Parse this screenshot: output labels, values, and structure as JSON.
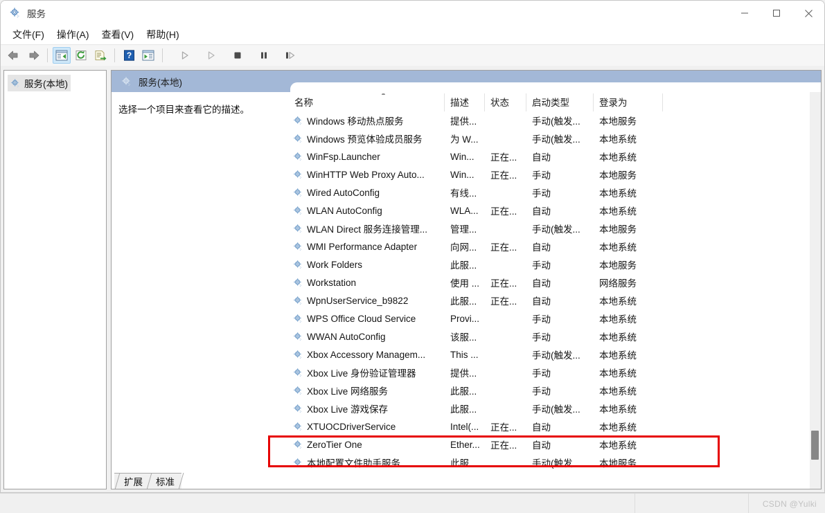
{
  "window": {
    "title": "服务",
    "icon": "services-gear-icon",
    "controls": {
      "minimize": "minimize-icon",
      "maximize": "maximize-icon",
      "close": "close-icon"
    }
  },
  "menubar": {
    "items": [
      {
        "label": "文件(F)",
        "name": "menu-file"
      },
      {
        "label": "操作(A)",
        "name": "menu-action"
      },
      {
        "label": "查看(V)",
        "name": "menu-view"
      },
      {
        "label": "帮助(H)",
        "name": "menu-help"
      }
    ]
  },
  "toolbar": {
    "buttons": [
      {
        "name": "back-button",
        "icon": "arrow-left-icon",
        "enabled": true
      },
      {
        "name": "forward-button",
        "icon": "arrow-right-icon",
        "enabled": true
      },
      {
        "name": "show-hide-console-tree-button",
        "icon": "console-tree-icon",
        "active": true
      },
      {
        "name": "refresh-button",
        "icon": "refresh-icon",
        "enabled": true
      },
      {
        "name": "export-list-button",
        "icon": "export-list-icon",
        "enabled": true
      },
      {
        "name": "help-button",
        "icon": "question-mark-icon",
        "enabled": true
      },
      {
        "name": "show-action-pane-button",
        "icon": "action-pane-icon",
        "enabled": true
      },
      {
        "name": "start-service-button",
        "icon": "play-icon",
        "enabled": false
      },
      {
        "name": "resume-service-button",
        "icon": "play-outline-icon",
        "enabled": false
      },
      {
        "name": "stop-service-button",
        "icon": "stop-icon",
        "enabled": true
      },
      {
        "name": "pause-service-button",
        "icon": "pause-icon",
        "enabled": true
      },
      {
        "name": "restart-service-button",
        "icon": "restart-icon",
        "enabled": true
      }
    ]
  },
  "sidebar": {
    "root": {
      "label": "服务(本地)",
      "icon": "services-gear-icon",
      "selected": true
    }
  },
  "banner": {
    "title": "服务(本地)",
    "icon": "services-gear-icon",
    "color": "#a3b8d7"
  },
  "description_pane": {
    "text": "选择一个项目来查看它的描述。"
  },
  "list": {
    "columns": [
      {
        "key": "name",
        "label": "名称",
        "sorted": "asc"
      },
      {
        "key": "desc",
        "label": "描述"
      },
      {
        "key": "state",
        "label": "状态"
      },
      {
        "key": "start",
        "label": "启动类型"
      },
      {
        "key": "logon",
        "label": "登录为"
      }
    ],
    "rows": [
      {
        "name": "Windows 移动热点服务",
        "desc": "提供...",
        "state": "",
        "start": "手动(触发...",
        "logon": "本地服务"
      },
      {
        "name": "Windows 预览体验成员服务",
        "desc": "为 W...",
        "state": "",
        "start": "手动(触发...",
        "logon": "本地系统"
      },
      {
        "name": "WinFsp.Launcher",
        "desc": "Win...",
        "state": "正在...",
        "start": "自动",
        "logon": "本地系统"
      },
      {
        "name": "WinHTTP Web Proxy Auto...",
        "desc": "Win...",
        "state": "正在...",
        "start": "手动",
        "logon": "本地服务"
      },
      {
        "name": "Wired AutoConfig",
        "desc": "有线...",
        "state": "",
        "start": "手动",
        "logon": "本地系统"
      },
      {
        "name": "WLAN AutoConfig",
        "desc": "WLA...",
        "state": "正在...",
        "start": "自动",
        "logon": "本地系统"
      },
      {
        "name": "WLAN Direct 服务连接管理...",
        "desc": "管理...",
        "state": "",
        "start": "手动(触发...",
        "logon": "本地服务"
      },
      {
        "name": "WMI Performance Adapter",
        "desc": "向网...",
        "state": "正在...",
        "start": "自动",
        "logon": "本地系统"
      },
      {
        "name": "Work Folders",
        "desc": "此服...",
        "state": "",
        "start": "手动",
        "logon": "本地服务"
      },
      {
        "name": "Workstation",
        "desc": "使用 ...",
        "state": "正在...",
        "start": "自动",
        "logon": "网络服务"
      },
      {
        "name": "WpnUserService_b9822",
        "desc": "此服...",
        "state": "正在...",
        "start": "自动",
        "logon": "本地系统"
      },
      {
        "name": "WPS Office Cloud Service",
        "desc": "Provi...",
        "state": "",
        "start": "手动",
        "logon": "本地系统"
      },
      {
        "name": "WWAN AutoConfig",
        "desc": "该服...",
        "state": "",
        "start": "手动",
        "logon": "本地系统"
      },
      {
        "name": "Xbox Accessory Managem...",
        "desc": "This ...",
        "state": "",
        "start": "手动(触发...",
        "logon": "本地系统"
      },
      {
        "name": "Xbox Live 身份验证管理器",
        "desc": "提供...",
        "state": "",
        "start": "手动",
        "logon": "本地系统"
      },
      {
        "name": "Xbox Live 网络服务",
        "desc": "此服...",
        "state": "",
        "start": "手动",
        "logon": "本地系统"
      },
      {
        "name": "Xbox Live 游戏保存",
        "desc": "此服...",
        "state": "",
        "start": "手动(触发...",
        "logon": "本地系统"
      },
      {
        "name": "XTUOCDriverService",
        "desc": "Intel(...",
        "state": "正在...",
        "start": "自动",
        "logon": "本地系统"
      },
      {
        "name": "ZeroTier One",
        "desc": "Ether...",
        "state": "正在...",
        "start": "自动",
        "logon": "本地系统"
      },
      {
        "name": "本地配置文件助手服务",
        "desc": "此服",
        "state": "",
        "start": "手动(触发",
        "logon": "本地服务"
      }
    ]
  },
  "annotation": {
    "highlight_color": "#e60000",
    "highlighted_row": "ZeroTier One"
  },
  "bottom_tabs": [
    {
      "label": "扩展",
      "name": "tab-extended",
      "selected": false
    },
    {
      "label": "标准",
      "name": "tab-standard",
      "selected": true
    }
  ],
  "watermark": {
    "text": "CSDN @Yulki"
  }
}
